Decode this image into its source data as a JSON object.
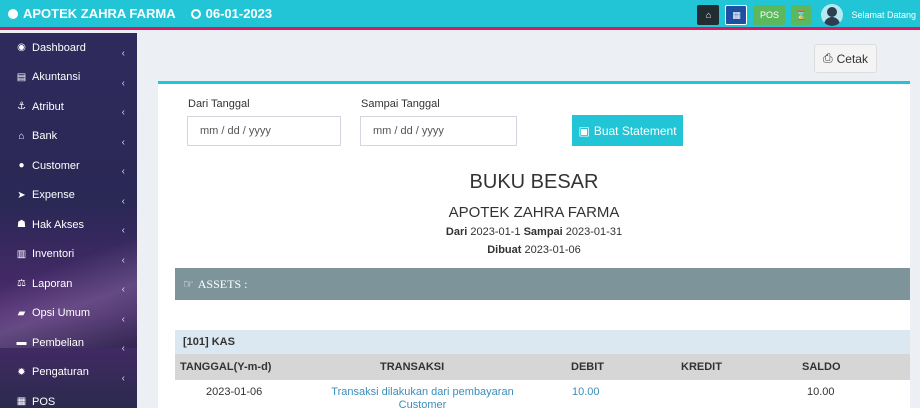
{
  "header": {
    "brand": "APOTEK ZAHRA FARMA",
    "date": "06-01-2023",
    "pos_label": "POS",
    "greeting": "Selamat Datang"
  },
  "sidebar": {
    "items": [
      {
        "label": "Dashboard",
        "icon": "dashboard-icon",
        "glyph": "◉"
      },
      {
        "label": "Akuntansi",
        "icon": "calculator-icon",
        "glyph": "▤"
      },
      {
        "label": "Atribut",
        "icon": "anchor-icon",
        "glyph": "⚓"
      },
      {
        "label": "Bank",
        "icon": "bank-icon",
        "glyph": "⌂"
      },
      {
        "label": "Customer",
        "icon": "user-icon",
        "glyph": "●"
      },
      {
        "label": "Expense",
        "icon": "send-icon",
        "glyph": "➤"
      },
      {
        "label": "Hak Akses",
        "icon": "users-icon",
        "glyph": "☗"
      },
      {
        "label": "Inventori",
        "icon": "barcode-icon",
        "glyph": "▥"
      },
      {
        "label": "Laporan",
        "icon": "balance-scale-icon",
        "glyph": "⚖"
      },
      {
        "label": "Opsi Umum",
        "icon": "building-icon",
        "glyph": "▰"
      },
      {
        "label": "Pembelian",
        "icon": "truck-icon",
        "glyph": "▬"
      },
      {
        "label": "Pengaturan",
        "icon": "gear-icon",
        "glyph": "✹"
      },
      {
        "label": "POS",
        "icon": "pos-icon",
        "glyph": "▦"
      }
    ]
  },
  "actions": {
    "print_label": "Cetak"
  },
  "form": {
    "from_label": "Dari Tanggal",
    "from_placeholder": "mm / dd / yyyy",
    "to_label": "Sampai Tanggal",
    "to_placeholder": "mm / dd / yyyy",
    "submit_label": "Buat Statement"
  },
  "report": {
    "title": "BUKU BESAR",
    "company": "APOTEK ZAHRA FARMA",
    "from_word": "Dari",
    "from_date": "2023-01-1",
    "to_word": "Sampai",
    "to_date": "2023-01-31",
    "created_word": "Dibuat",
    "created_date": "2023-01-06"
  },
  "section": {
    "assets_label": "ASSETS :"
  },
  "account": {
    "name": "[101] KAS"
  },
  "table": {
    "columns": [
      "TANGGAL(Y-m-d)",
      "TRANSAKSI",
      "DEBIT",
      "KREDIT",
      "SALDO"
    ],
    "rows": [
      {
        "date": "2023-01-06",
        "transaction": "Transaksi dilakukan dari pembayaran Customer",
        "debit": "10.00",
        "credit": "",
        "balance": "10.00"
      }
    ]
  },
  "colors": {
    "header_bg": "#22c5d6",
    "header_border": "#d81b60",
    "assets_bar": "#7e949b",
    "account_bar": "#dbe7f1"
  }
}
